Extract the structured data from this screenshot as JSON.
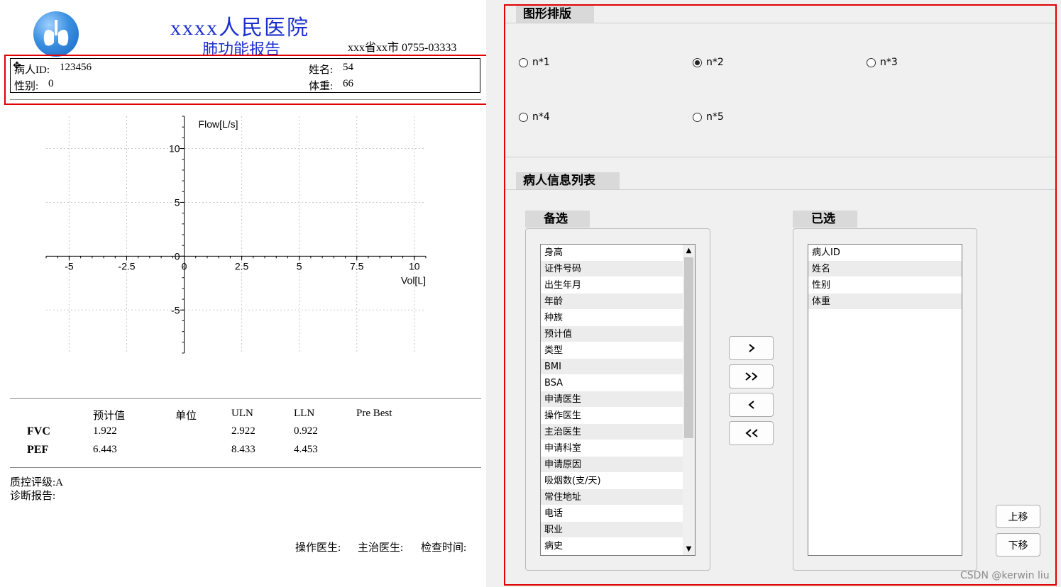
{
  "report": {
    "hospital_name": "xxxx人民医院",
    "report_title": "肺功能报告",
    "contact": "xxx省xx市 0755-03333",
    "patient_info": {
      "id_label": "病人ID:",
      "id_value": "123456",
      "name_label": "姓名:",
      "name_value": "54",
      "sex_label": "性别:",
      "sex_value": "0",
      "weight_label": "体重:",
      "weight_value": "66"
    },
    "results_table": {
      "headers": [
        "预计值",
        "单位",
        "ULN",
        "LLN",
        "Pre Best"
      ],
      "rows": [
        {
          "name": "FVC",
          "pred": "1.922",
          "unit": "",
          "uln": "2.922",
          "lln": "0.922",
          "pre_best": ""
        },
        {
          "name": "PEF",
          "pred": "6.443",
          "unit": "",
          "uln": "8.433",
          "lln": "4.453",
          "pre_best": ""
        }
      ]
    },
    "quality_grade": "质控评级:A",
    "diagnosis_label": "诊断报告:",
    "footer": {
      "operator_label": "操作医生:",
      "attending_label": "主治医生:",
      "exam_time_label": "检查时间:"
    }
  },
  "chart_data": {
    "type": "line",
    "title": "",
    "xlabel": "Vol[L]",
    "ylabel": "Flow[L/s]",
    "xlim": [
      -6,
      10.5
    ],
    "ylim": [
      -9,
      13
    ],
    "x_ticks": [
      -5,
      -2.5,
      0,
      2.5,
      5,
      7.5,
      10
    ],
    "x_tick_labels": [
      "-5",
      "-2.5",
      "0",
      "2.5",
      "5",
      "7.5",
      "10"
    ],
    "y_ticks": [
      -5,
      0,
      5,
      10
    ],
    "y_tick_labels": [
      "-5",
      "0",
      "5",
      "10"
    ],
    "grid": true,
    "series": []
  },
  "layout_panel": {
    "section_title": "图形排版",
    "options": [
      "n*1",
      "n*2",
      "n*3",
      "n*4",
      "n*5"
    ],
    "selected": "n*2"
  },
  "patient_list_panel": {
    "section_title": "病人信息列表",
    "available_title": "备选",
    "available_items": [
      "身高",
      "证件号码",
      "出生年月",
      "年龄",
      "种族",
      "预计值",
      "类型",
      "BMI",
      "BSA",
      "申请医生",
      "操作医生",
      "主治医生",
      "申请科室",
      "申请原因",
      "吸烟数(支/天)",
      "常住地址",
      "电话",
      "职业",
      "病史"
    ],
    "selected_title": "已选",
    "selected_items": [
      "病人ID",
      "姓名",
      "性别",
      "体重"
    ],
    "buttons": {
      "add_one": "›",
      "add_all": "»",
      "remove_one": "‹",
      "remove_all": "«",
      "move_up": "上移",
      "move_down": "下移"
    }
  },
  "watermark": "CSDN @kerwin liu",
  "colors": {
    "highlight_border": "#e00000",
    "hospital_title": "#1b2fd0",
    "panel_background": "#f0f0f0"
  }
}
